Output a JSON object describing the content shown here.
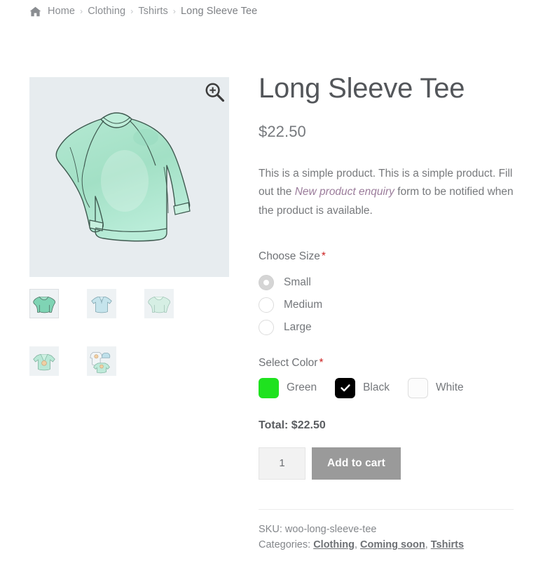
{
  "breadcrumb": {
    "home_icon": "home-icon",
    "separator": "›",
    "items": [
      {
        "label": "Home",
        "current": false
      },
      {
        "label": "Clothing",
        "current": false
      },
      {
        "label": "Tshirts",
        "current": false
      },
      {
        "label": "Long Sleeve Tee",
        "current": true
      }
    ]
  },
  "gallery": {
    "zoom_icon": "magnifier-plus-icon",
    "main_image_alt": "Long Sleeve Tee",
    "main_bg": "#e7ecef",
    "thumbnails": [
      {
        "alt": "Long sleeve tee green",
        "kind": "longsleeve-dark",
        "active": true
      },
      {
        "alt": "Polo tshirt blue",
        "kind": "polo",
        "active": false
      },
      {
        "alt": "Long sleeve tee light",
        "kind": "longsleeve-light",
        "active": false
      },
      {
        "alt": "V-neck tee with pendant",
        "kind": "vneck",
        "active": false
      },
      {
        "alt": "Clothing bundle",
        "kind": "bundle",
        "active": false
      }
    ]
  },
  "product": {
    "title": "Long Sleeve Tee",
    "price": "$22.50",
    "description_before": "This is a simple product. This is a simple product. Fill out the ",
    "description_link": "New product enquiry",
    "description_after": " form to be notified when the product is available."
  },
  "size_field": {
    "label": "Choose Size",
    "required_mark": "*",
    "options": [
      {
        "label": "Small",
        "checked": true
      },
      {
        "label": "Medium",
        "checked": false
      },
      {
        "label": "Large",
        "checked": false
      }
    ]
  },
  "color_field": {
    "label": "Select Color",
    "required_mark": "*",
    "options": [
      {
        "label": "Green",
        "color": "#1fe21f",
        "checked": false,
        "border": "none"
      },
      {
        "label": "Black",
        "color": "#000000",
        "checked": true,
        "border": "none"
      },
      {
        "label": "White",
        "color": "#fcfcfc",
        "checked": false,
        "border": "#dedede"
      }
    ]
  },
  "cart": {
    "total_label": "Total: $22.50",
    "quantity_value": "1",
    "quantity_placeholder": "1",
    "add_to_cart_label": "Add to cart"
  },
  "meta": {
    "sku_label": "SKU:",
    "sku_value": "woo-long-sleeve-tee",
    "categories_label": "Categories:",
    "categories": [
      "Clothing",
      "Coming soon",
      "Tshirts"
    ],
    "categories_separator": ", "
  },
  "colors": {
    "accent_required": "#cc2222",
    "button_bg": "#9a9a9a",
    "text_muted": "#77797c",
    "link_enquiry": "#9b7c9b",
    "garment_mint": "#a5e3c8"
  }
}
